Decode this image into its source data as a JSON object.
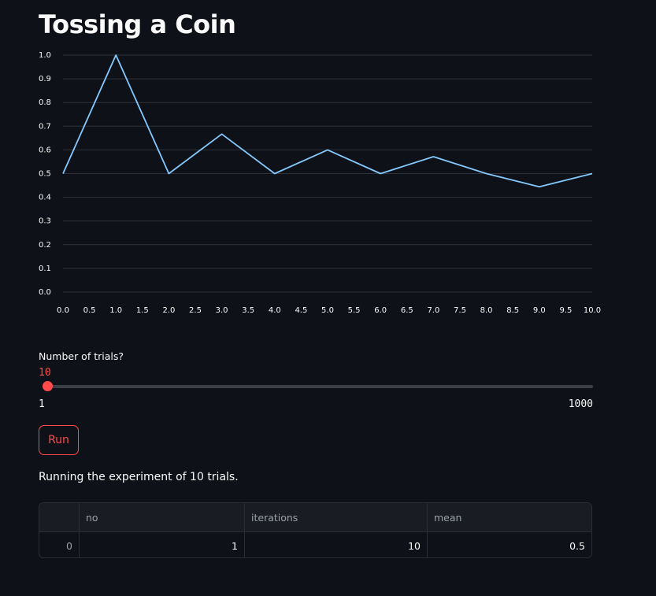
{
  "page": {
    "title": "Tossing a Coin"
  },
  "chart_data": {
    "type": "line",
    "x": [
      0,
      1,
      2,
      3,
      4,
      5,
      6,
      7,
      8,
      9,
      10
    ],
    "series": [
      {
        "values": [
          0.5,
          1.0,
          0.5,
          0.6667,
          0.5,
          0.6,
          0.5,
          0.5714,
          0.5,
          0.4444,
          0.5
        ],
        "color": "#83c9ff"
      }
    ],
    "xlim": [
      0,
      10
    ],
    "ylim": [
      0,
      1
    ],
    "xticks": [
      "0.0",
      "0.5",
      "1.0",
      "1.5",
      "2.0",
      "2.5",
      "3.0",
      "3.5",
      "4.0",
      "4.5",
      "5.0",
      "5.5",
      "6.0",
      "6.5",
      "7.0",
      "7.5",
      "8.0",
      "8.5",
      "9.0",
      "9.5",
      "10.0"
    ],
    "yticks": [
      "0.0",
      "0.1",
      "0.2",
      "0.3",
      "0.4",
      "0.5",
      "0.6",
      "0.7",
      "0.8",
      "0.9",
      "1.0"
    ],
    "grid": true,
    "title": "",
    "xlabel": "",
    "ylabel": ""
  },
  "slider": {
    "label": "Number of trials?",
    "value": "10",
    "min": "1",
    "max": "1000",
    "fraction": 0.009
  },
  "run_button": {
    "label": "Run"
  },
  "status": {
    "text": "Running the experiment of 10 trials."
  },
  "table": {
    "columns": [
      "",
      "no",
      "iterations",
      "mean"
    ],
    "rows": [
      [
        "0",
        "1",
        "10",
        "0.5"
      ]
    ]
  },
  "colors": {
    "background": "#0e1117",
    "accent": "#ff4b4b",
    "line": "#83c9ff",
    "text": "#fafafa"
  }
}
